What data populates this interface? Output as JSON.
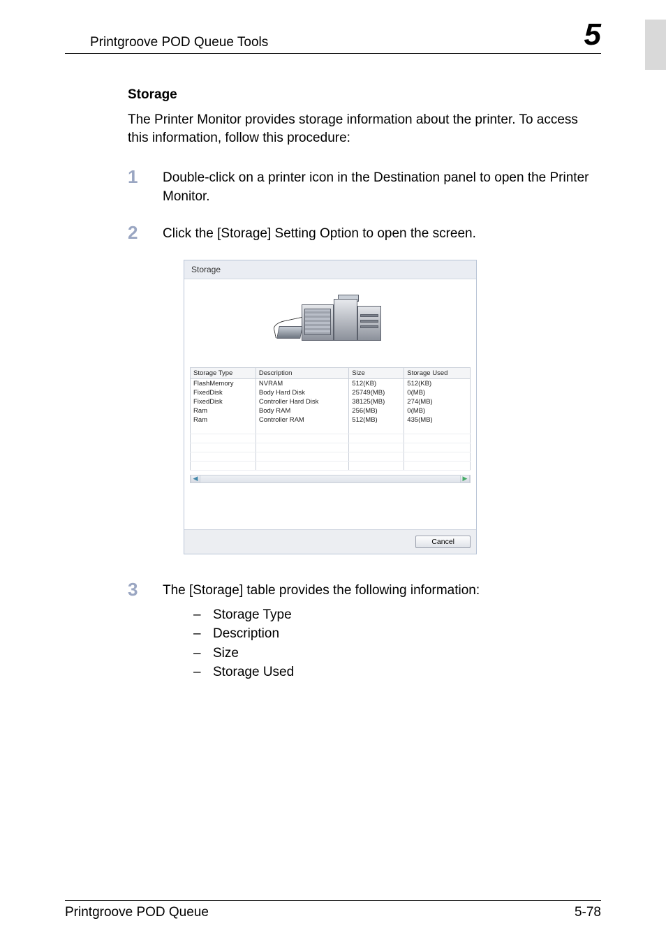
{
  "header": {
    "left": "Printgroove POD Queue Tools",
    "right": "5"
  },
  "section": {
    "title": "Storage",
    "intro": "The Printer Monitor provides storage information about the printer. To access this information, follow this procedure:"
  },
  "steps": {
    "s1": {
      "num": "1",
      "text": "Double-click on a printer icon in the Destination panel to open the Printer Monitor."
    },
    "s2": {
      "num": "2",
      "text": "Click the [Storage] Setting Option to open the screen."
    },
    "s3": {
      "num": "3",
      "text": "The [Storage] table provides the following information:"
    }
  },
  "dialog": {
    "title": "Storage",
    "headers": {
      "c1": "Storage Type",
      "c2": "Description",
      "c3": "Size",
      "c4": "Storage Used"
    },
    "rows": [
      {
        "c1": "FlashMemory",
        "c2": "NVRAM",
        "c3": "512(KB)",
        "c4": "512(KB)"
      },
      {
        "c1": "FixedDisk",
        "c2": "Body Hard Disk",
        "c3": "25749(MB)",
        "c4": "0(MB)"
      },
      {
        "c1": "FixedDisk",
        "c2": "Controller Hard Disk",
        "c3": "38125(MB)",
        "c4": "274(MB)"
      },
      {
        "c1": "Ram",
        "c2": "Body RAM",
        "c3": "256(MB)",
        "c4": "0(MB)"
      },
      {
        "c1": "Ram",
        "c2": "Controller RAM",
        "c3": "512(MB)",
        "c4": "435(MB)"
      }
    ],
    "cancel": "Cancel"
  },
  "bullets": {
    "b1": "Storage Type",
    "b2": "Description",
    "b3": "Size",
    "b4": "Storage Used"
  },
  "footer": {
    "left": "Printgroove POD Queue",
    "right": "5-78"
  },
  "chart_data": {
    "type": "table",
    "title": "Storage",
    "columns": [
      "Storage Type",
      "Description",
      "Size",
      "Storage Used"
    ],
    "rows": [
      [
        "FlashMemory",
        "NVRAM",
        "512(KB)",
        "512(KB)"
      ],
      [
        "FixedDisk",
        "Body Hard Disk",
        "25749(MB)",
        "0(MB)"
      ],
      [
        "FixedDisk",
        "Controller Hard Disk",
        "38125(MB)",
        "274(MB)"
      ],
      [
        "Ram",
        "Body RAM",
        "256(MB)",
        "0(MB)"
      ],
      [
        "Ram",
        "Controller RAM",
        "512(MB)",
        "435(MB)"
      ]
    ]
  }
}
